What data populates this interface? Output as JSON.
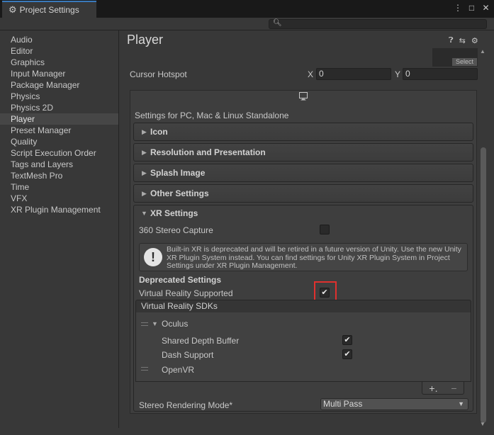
{
  "window": {
    "tab_title": "Project Settings",
    "controls": [
      "⋮",
      "□",
      "✕"
    ]
  },
  "search": {
    "placeholder": ""
  },
  "sidebar": {
    "items": [
      {
        "label": "Audio",
        "active": false
      },
      {
        "label": "Editor",
        "active": false
      },
      {
        "label": "Graphics",
        "active": false
      },
      {
        "label": "Input Manager",
        "active": false
      },
      {
        "label": "Package Manager",
        "active": false
      },
      {
        "label": "Physics",
        "active": false
      },
      {
        "label": "Physics 2D",
        "active": false
      },
      {
        "label": "Player",
        "active": true
      },
      {
        "label": "Preset Manager",
        "active": false
      },
      {
        "label": "Quality",
        "active": false
      },
      {
        "label": "Script Execution Order",
        "active": false
      },
      {
        "label": "Tags and Layers",
        "active": false
      },
      {
        "label": "TextMesh Pro",
        "active": false
      },
      {
        "label": "Time",
        "active": false
      },
      {
        "label": "VFX",
        "active": false
      },
      {
        "label": "XR Plugin Management",
        "active": false
      }
    ]
  },
  "main": {
    "title": "Player",
    "icon_slot_button": "Select",
    "cursor_hotspot": {
      "label": "Cursor Hotspot",
      "x_label": "X",
      "x_value": "0",
      "y_label": "Y",
      "y_value": "0"
    },
    "platform_label": "Settings for PC, Mac & Linux Standalone",
    "foldouts": [
      "Icon",
      "Resolution and Presentation",
      "Splash Image",
      "Other Settings"
    ],
    "xr": {
      "title": "XR Settings",
      "stereo_capture_label": "360 Stereo Capture",
      "stereo_capture_checked": false,
      "help_text": "Built-in XR is deprecated and will be retired in a future version of Unity. Use the new Unity XR Plugin System instead. You can find settings for Unity XR Plugin System in Project Settings under XR Plugin Management.",
      "deprecated_label": "Deprecated Settings",
      "vr_supported_label": "Virtual Reality Supported",
      "vr_supported_checked": true,
      "sdks_header": "Virtual Reality SDKs",
      "sdks": {
        "oculus": {
          "name": "Oculus",
          "shared_depth_label": "Shared Depth Buffer",
          "shared_depth_checked": true,
          "dash_support_label": "Dash Support",
          "dash_support_checked": true
        },
        "openvr": {
          "name": "OpenVR"
        }
      },
      "add_glyph": "+.",
      "remove_glyph": "−",
      "stereo_mode_label": "Stereo Rendering Mode*",
      "stereo_mode_value": "Multi Pass"
    }
  },
  "colors": {
    "background": "#383838",
    "titlebar": "#191919",
    "tab_accent": "#3a79bb",
    "highlight": "#e0302e"
  }
}
